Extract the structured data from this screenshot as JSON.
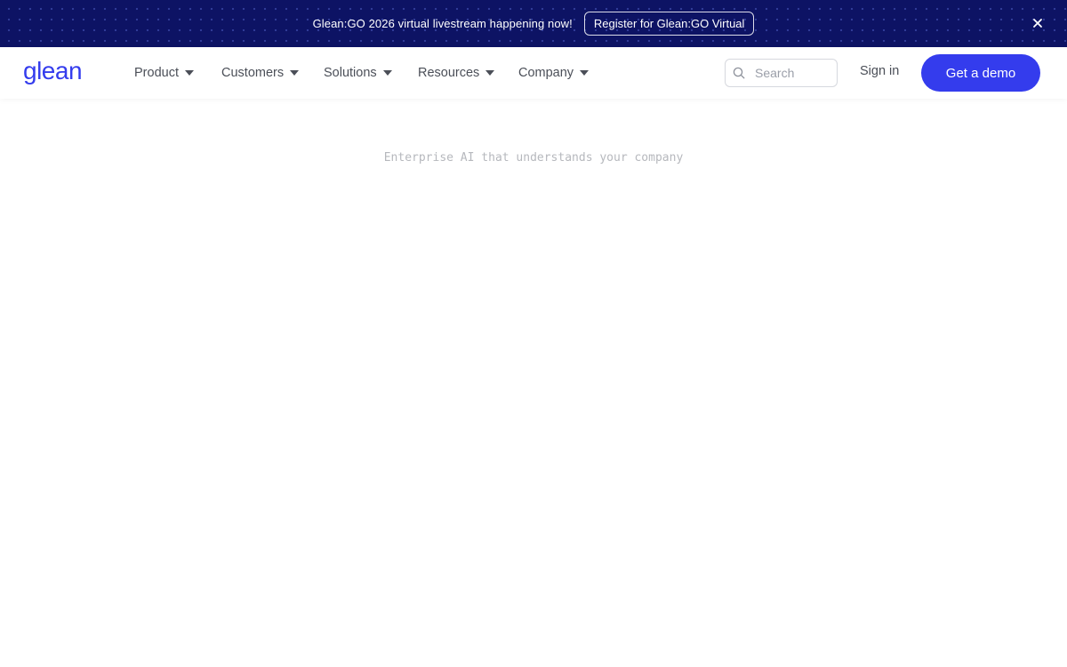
{
  "banner": {
    "text": "Glean:GO 2026 virtual livestream happening now!",
    "button_label": "Register for Glean:GO Virtual",
    "close_icon": "close-icon"
  },
  "header": {
    "logo_text": "glean",
    "nav": [
      {
        "label": "Product",
        "icon": "chevron-down-icon"
      },
      {
        "label": "Customers",
        "icon": "chevron-down-icon"
      },
      {
        "label": "Solutions",
        "icon": "chevron-down-icon"
      },
      {
        "label": "Resources",
        "icon": "chevron-down-icon"
      },
      {
        "label": "Company",
        "icon": "chevron-down-icon"
      }
    ],
    "search": {
      "placeholder": "Search",
      "icon": "search-icon"
    },
    "sign_in_label": "Sign in",
    "demo_label": "Get a demo"
  },
  "hero": {
    "tagline": "Enterprise AI that understands your company"
  },
  "colors": {
    "banner_bg": "#0d1364",
    "accent": "#343ced",
    "nav_text": "#4b4f58",
    "tagline_text": "#b6b8bd"
  }
}
